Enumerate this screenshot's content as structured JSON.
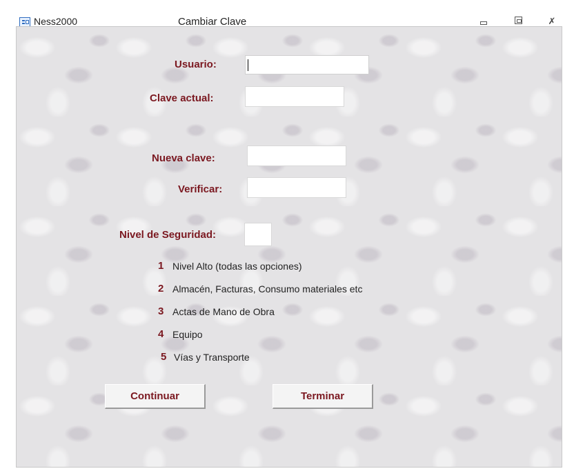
{
  "window": {
    "app_name": "Ness2000",
    "title": "Cambiar Clave",
    "icon": "form-icon",
    "controls": [
      "minimize-icon",
      "maximize-icon",
      "close-icon"
    ],
    "close_glyph": "✗"
  },
  "form": {
    "usuario_label": "Usuario:",
    "usuario_value": "",
    "clave_actual_label": "Clave actual:",
    "clave_actual_value": "",
    "nueva_clave_label": "Nueva clave:",
    "nueva_clave_value": "",
    "verificar_label": "Verificar:",
    "verificar_value": "",
    "nivel_label": "Nivel de Seguridad:",
    "nivel_value": ""
  },
  "levels": [
    {
      "num": "1",
      "text": "Nivel Alto (todas las opciones)"
    },
    {
      "num": "2",
      "text": "Almacén, Facturas, Consumo materiales etc"
    },
    {
      "num": "3",
      "text": "Actas de Mano de Obra"
    },
    {
      "num": "4",
      "text": "Equipo"
    },
    {
      "num": "5",
      "text": "Vías y Transporte"
    }
  ],
  "buttons": {
    "continuar": "Continuar",
    "terminar": "Terminar"
  },
  "colors": {
    "label": "#7b1820",
    "background": "#e4e3e5"
  }
}
